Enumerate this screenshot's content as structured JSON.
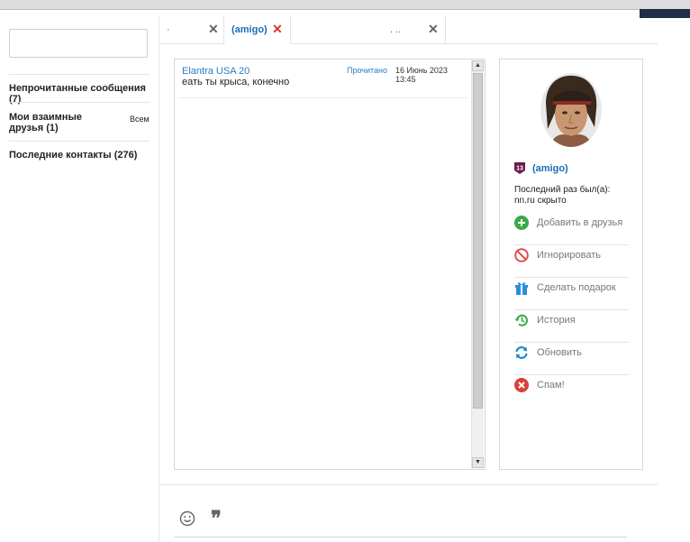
{
  "sidebar": {
    "search": {
      "value": "",
      "placeholder": ""
    },
    "items": [
      {
        "label": "Непрочитанные сообщения (7)"
      },
      {
        "label": "Мои взаимные друзья (1)",
        "action": "Всем"
      },
      {
        "label": "Последние контакты (276)"
      }
    ]
  },
  "tabs": [
    {
      "label": "·",
      "active": false
    },
    {
      "label": "(amigo)",
      "active": true
    },
    {
      "label": ". ..",
      "active": false
    }
  ],
  "message": {
    "sender": "Elantra USA 20",
    "status": "Прочитано",
    "time": "16 Июнь 2023 13:45",
    "text": "еать ты крыса, конечно"
  },
  "profile": {
    "level": "13",
    "name": "(amigo)",
    "last_seen": "Последний раз был(а): nn.ru скрыто",
    "actions": [
      {
        "label": "Добавить в друзья",
        "icon": "plus-circle-icon"
      },
      {
        "label": "Игнорировать",
        "icon": "block-icon"
      },
      {
        "label": "Сделать подарок",
        "icon": "gift-icon"
      },
      {
        "label": "История",
        "icon": "history-icon"
      },
      {
        "label": "Обновить",
        "icon": "refresh-icon"
      },
      {
        "label": "Спам!",
        "icon": "spam-icon"
      }
    ]
  },
  "colors": {
    "link": "#1a6cb5",
    "add_green": "#3aa94a",
    "ignore_red": "#d9534f",
    "gift_blue": "#2a8fd6",
    "history_green": "#39a845",
    "refresh_blue": "#1f86cf",
    "spam_red": "#d9413b",
    "badge_purple": "#6b1b4f"
  }
}
